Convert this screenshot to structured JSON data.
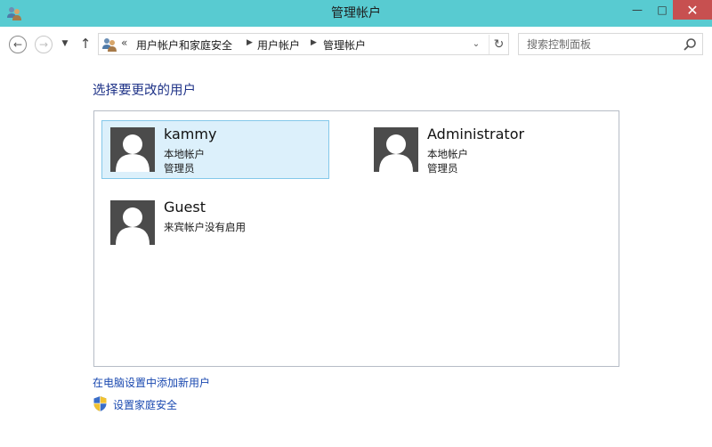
{
  "window": {
    "title": "管理帐户",
    "minimize_glyph": "—",
    "maximize_glyph": "□",
    "close_glyph": "✕"
  },
  "nav": {
    "back_glyph": "←",
    "forward_glyph": "→",
    "recent_glyph": "▼",
    "up_glyph": "↑"
  },
  "address": {
    "overflow_glyph": "«",
    "crumbs": [
      "用户帐户和家庭安全",
      "用户帐户",
      "管理帐户"
    ],
    "separator_glyph": "▶",
    "dropdown_glyph": "⌄",
    "refresh_glyph": "↻"
  },
  "search": {
    "placeholder": "搜索控制面板"
  },
  "main": {
    "title": "选择要更改的用户",
    "users": [
      {
        "name": "kammy",
        "line1": "本地帐户",
        "line2": "管理员",
        "selected": true
      },
      {
        "name": "Administrator",
        "line1": "本地帐户",
        "line2": "管理员",
        "selected": false
      },
      {
        "name": "Guest",
        "line1": "来宾帐户没有启用",
        "line2": "",
        "selected": false
      }
    ],
    "add_user_link": "在电脑设置中添加新用户",
    "family_safety_link": "设置家庭安全"
  },
  "colors": {
    "titlebar": "#58cbd1",
    "link": "#1a49b0",
    "heading": "#1e3287",
    "selected_bg": "#dcf0fb",
    "selected_border": "#84c8ea",
    "avatar": "#4b4b4b"
  },
  "icons": {
    "window": "users-icon",
    "address": "control-panel-users-icon",
    "search": "search-icon",
    "family": "uac-shield-icon",
    "avatar": "user-silhouette-icon"
  }
}
